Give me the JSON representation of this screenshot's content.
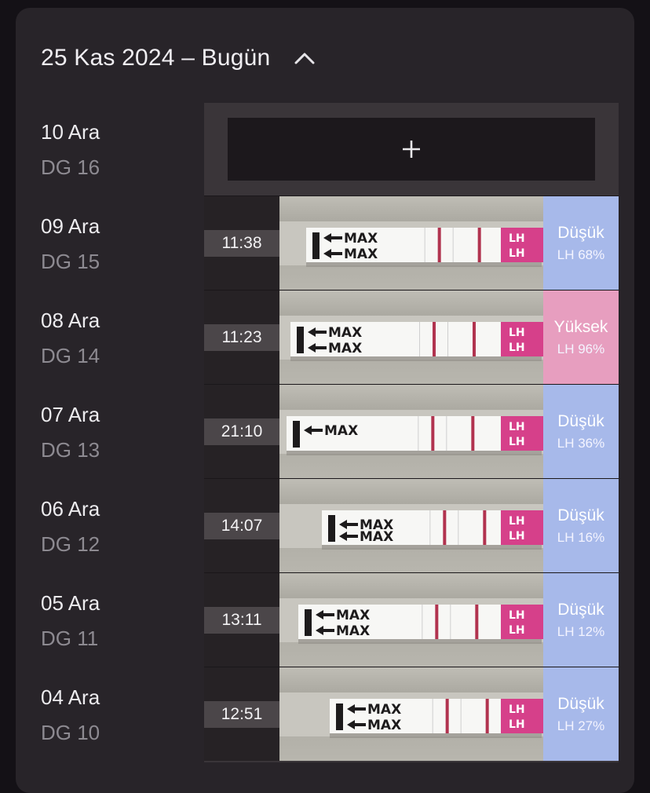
{
  "header": {
    "title": "25 Kas 2024 – Bugün",
    "icon": "chevron-up-icon"
  },
  "colors": {
    "low": "#a7b9ea",
    "high": "#e79ebf",
    "card": "#282429"
  },
  "add_button": {
    "icon": "plus-icon"
  },
  "days": [
    {
      "date": "10 Ara",
      "cycle_day": "DG 16"
    },
    {
      "date": "09 Ara",
      "cycle_day": "DG 15"
    },
    {
      "date": "08 Ara",
      "cycle_day": "DG 14"
    },
    {
      "date": "07 Ara",
      "cycle_day": "DG 13"
    },
    {
      "date": "06 Ara",
      "cycle_day": "DG 12"
    },
    {
      "date": "05 Ara",
      "cycle_day": "DG 11"
    },
    {
      "date": "04 Ara",
      "cycle_day": "DG 10"
    }
  ],
  "tests": [
    {
      "time": "11:38",
      "result": "Düşük",
      "lh": "LH 68%",
      "level": "low"
    },
    {
      "time": "11:23",
      "result": "Yüksek",
      "lh": "LH 96%",
      "level": "high"
    },
    {
      "time": "21:10",
      "result": "Düşük",
      "lh": "LH 36%",
      "level": "low"
    },
    {
      "time": "14:07",
      "result": "Düşük",
      "lh": "LH 16%",
      "level": "low"
    },
    {
      "time": "13:11",
      "result": "Düşük",
      "lh": "LH 12%",
      "level": "low"
    },
    {
      "time": "12:51",
      "result": "Düşük",
      "lh": "LH 27%",
      "level": "low"
    }
  ],
  "strip": {
    "arrow_text": "MAX",
    "cap_text": "LH"
  }
}
